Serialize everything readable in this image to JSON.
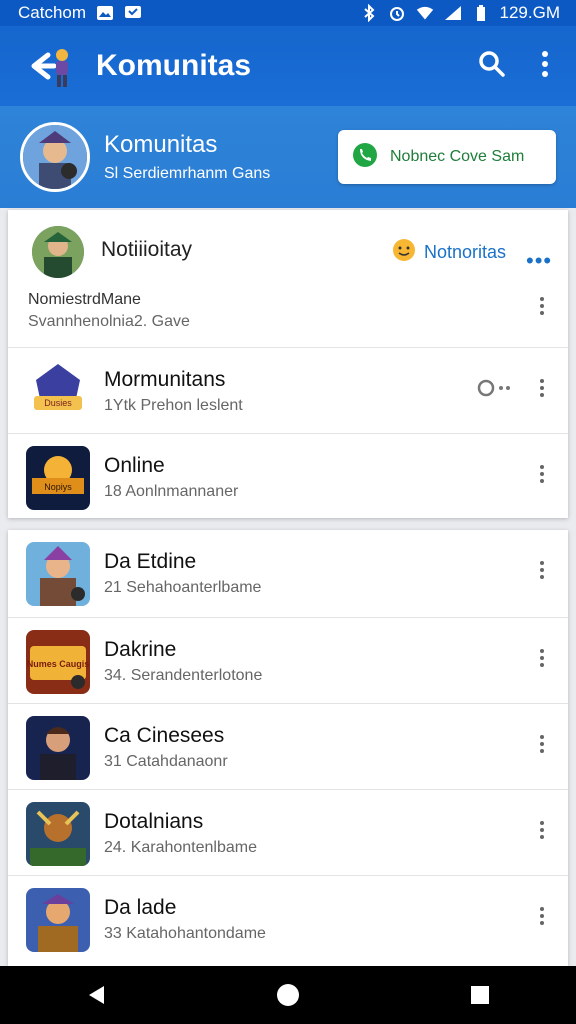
{
  "status_bar": {
    "carrier": "Catchom",
    "time": "129.GM",
    "icons": [
      "image-icon",
      "message-icon",
      "bluetooth-icon",
      "alarm-icon",
      "wifi-icon",
      "signal-icon",
      "battery-icon"
    ]
  },
  "app_bar": {
    "title": "Komunitas",
    "back_icon": "back-arrow-icon",
    "search_icon": "search-icon",
    "more_icon": "more-vert-icon"
  },
  "banner": {
    "title": "Komunitas",
    "subtitle": "Sl  Serdiemrhanm Gans",
    "button_label": "Nobnec Cove Sam"
  },
  "notification": {
    "title": "Notiiioitay",
    "tag": "Notnoritas",
    "more": "•••",
    "name": "NomiestrdMane",
    "subtitle": "Svannhenolnia2. Gave"
  },
  "list_top": [
    {
      "title": "Mormunitans",
      "subtitle": "1Ytk  Prehon leslent",
      "has_toggle": true
    },
    {
      "title": "Online",
      "subtitle": "18  Aonlnmannaner",
      "has_toggle": false
    }
  ],
  "list_main": [
    {
      "title": "Da Etdine",
      "subtitle": "21  Sehahoanterlbame"
    },
    {
      "title": "Dakrine",
      "subtitle": "34.  Serandenterlotone"
    },
    {
      "title": "Ca Cinesees",
      "subtitle": "31  Catahdanaonr"
    },
    {
      "title": "Dotalnians",
      "subtitle": "24.  Karahontenlbame"
    },
    {
      "title": "Da lade",
      "subtitle": "33  Katahohantondame"
    }
  ],
  "thumb_labels": {
    "top_0": "Dusies",
    "top_1": "Nopiys",
    "main_1": "Numes Caugis"
  },
  "colors": {
    "app_bar": "#1566cd",
    "banner": "#2e84d9",
    "accent_text": "#1a72c8",
    "join_green": "#21a644"
  }
}
